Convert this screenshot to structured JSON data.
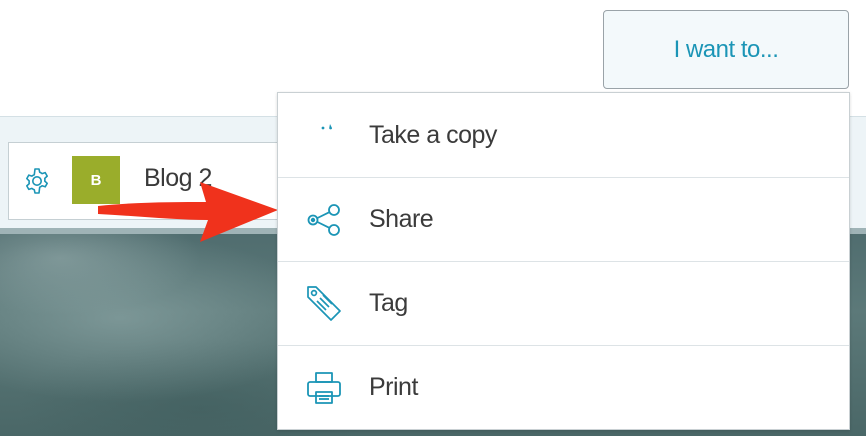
{
  "actions_button": {
    "label": "I want to..."
  },
  "blog_header": {
    "avatar_letter": "B",
    "blog_name": "Blog 2",
    "settings_icon": "gear-icon"
  },
  "menu": {
    "items": [
      {
        "label": "Take a copy",
        "icon": "copy-icon"
      },
      {
        "label": "Share",
        "icon": "share-icon"
      },
      {
        "label": "Tag",
        "icon": "tag-icon"
      },
      {
        "label": "Print",
        "icon": "printer-icon"
      }
    ]
  },
  "annotation": {
    "arrow_icon": "red-arrow-icon"
  },
  "colors": {
    "accent": "#1b95b6",
    "avatar_bg": "#9aad2b",
    "annotation_arrow": "#f0321c",
    "text_dark": "#3b3b3b"
  }
}
